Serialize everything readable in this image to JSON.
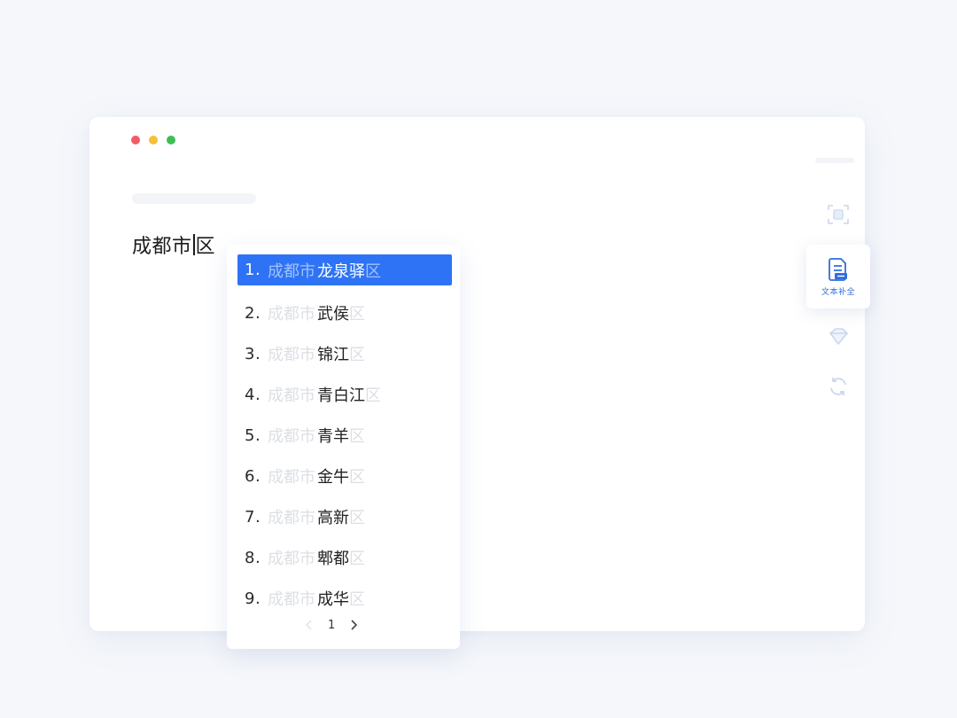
{
  "editor": {
    "text_before_caret": "成都市",
    "text_after_caret": "区"
  },
  "suggestions": [
    {
      "num": "1.",
      "prefix": "成都市",
      "name": "龙泉驿",
      "suffix": "区",
      "active": true
    },
    {
      "num": "2.",
      "prefix": "成都市",
      "name": "武侯",
      "suffix": "区"
    },
    {
      "num": "3.",
      "prefix": "成都市",
      "name": "锦江",
      "suffix": "区"
    },
    {
      "num": "4.",
      "prefix": "成都市",
      "name": "青白江",
      "suffix": "区"
    },
    {
      "num": "5.",
      "prefix": "成都市",
      "name": "青羊",
      "suffix": "区"
    },
    {
      "num": "6.",
      "prefix": "成都市",
      "name": "金牛",
      "suffix": "区"
    },
    {
      "num": "7.",
      "prefix": "成都市",
      "name": "高新",
      "suffix": "区"
    },
    {
      "num": "8.",
      "prefix": "成都市",
      "name": "郫都",
      "suffix": "区"
    },
    {
      "num": "9.",
      "prefix": "成都市",
      "name": "成华",
      "suffix": "区"
    }
  ],
  "pager": {
    "page": "1",
    "prev_icon": "chevron-left-icon",
    "next_icon": "chevron-right-icon"
  },
  "sidebar_tools": {
    "scan_icon": "scan-icon",
    "text_complete_icon": "document-icon",
    "text_complete_label": "文本补全",
    "tag_icon": "tag-icon",
    "refresh_icon": "refresh-icon"
  },
  "colors": {
    "accent": "#2e73f5",
    "traffic_red": "#f25a67",
    "traffic_yellow": "#f6bf3c",
    "traffic_green": "#3dbf55"
  }
}
